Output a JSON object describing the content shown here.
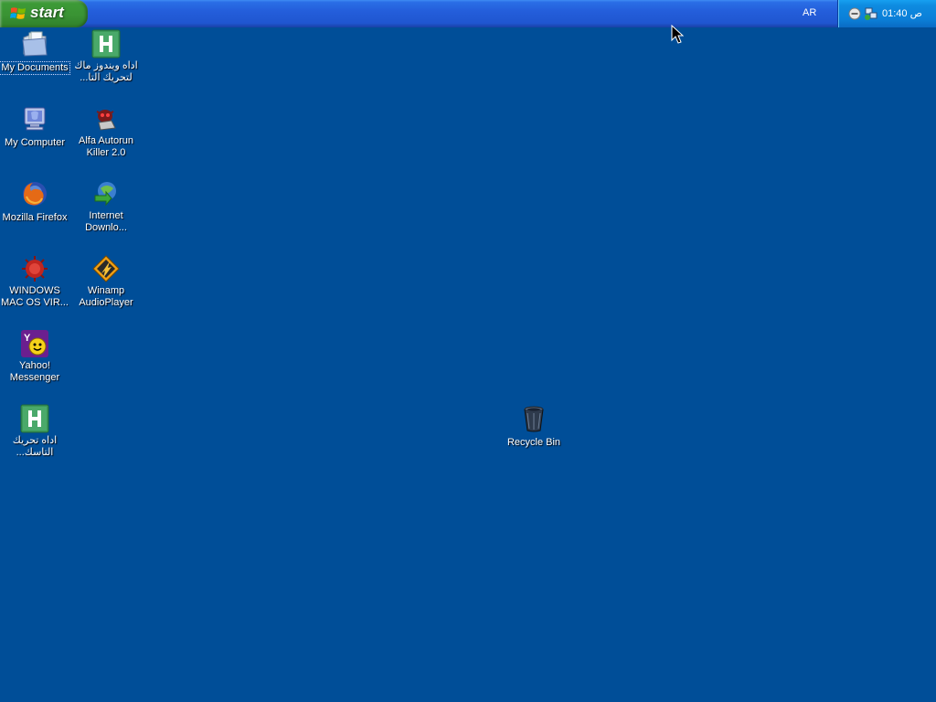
{
  "taskbar": {
    "start_label": "start",
    "language": "AR",
    "clock": "ص 01:40"
  },
  "desktop_icons": [
    {
      "label": "My Documents",
      "icon": "folder-documents-icon"
    },
    {
      "label": "اداه ويندوز ماك لتحريك التا...",
      "icon": "h-app-icon"
    },
    {
      "label": "My Computer",
      "icon": "computer-icon"
    },
    {
      "label": "Alfa Autorun Killer 2.0",
      "icon": "bug-robot-icon"
    },
    {
      "label": "Mozilla Firefox",
      "icon": "firefox-icon"
    },
    {
      "label": "Internet Downlo...",
      "icon": "download-manager-icon"
    },
    {
      "label": "WINDOWS MAC OS VIR...",
      "icon": "virus-icon"
    },
    {
      "label": "Winamp AudioPlayer",
      "icon": "winamp-icon"
    },
    {
      "label": "Yahoo! Messenger",
      "icon": "yahoo-messenger-icon"
    },
    {
      "label": "اداه تحريك التاسك...",
      "icon": "h-app-icon"
    },
    {
      "label": "Recycle Bin",
      "icon": "recycle-bin-icon"
    }
  ],
  "colors": {
    "desktop_background": "#004e98",
    "taskbar_blue": "#245edb",
    "start_green": "#3a9334",
    "tray_blue": "#0b7fd8"
  }
}
